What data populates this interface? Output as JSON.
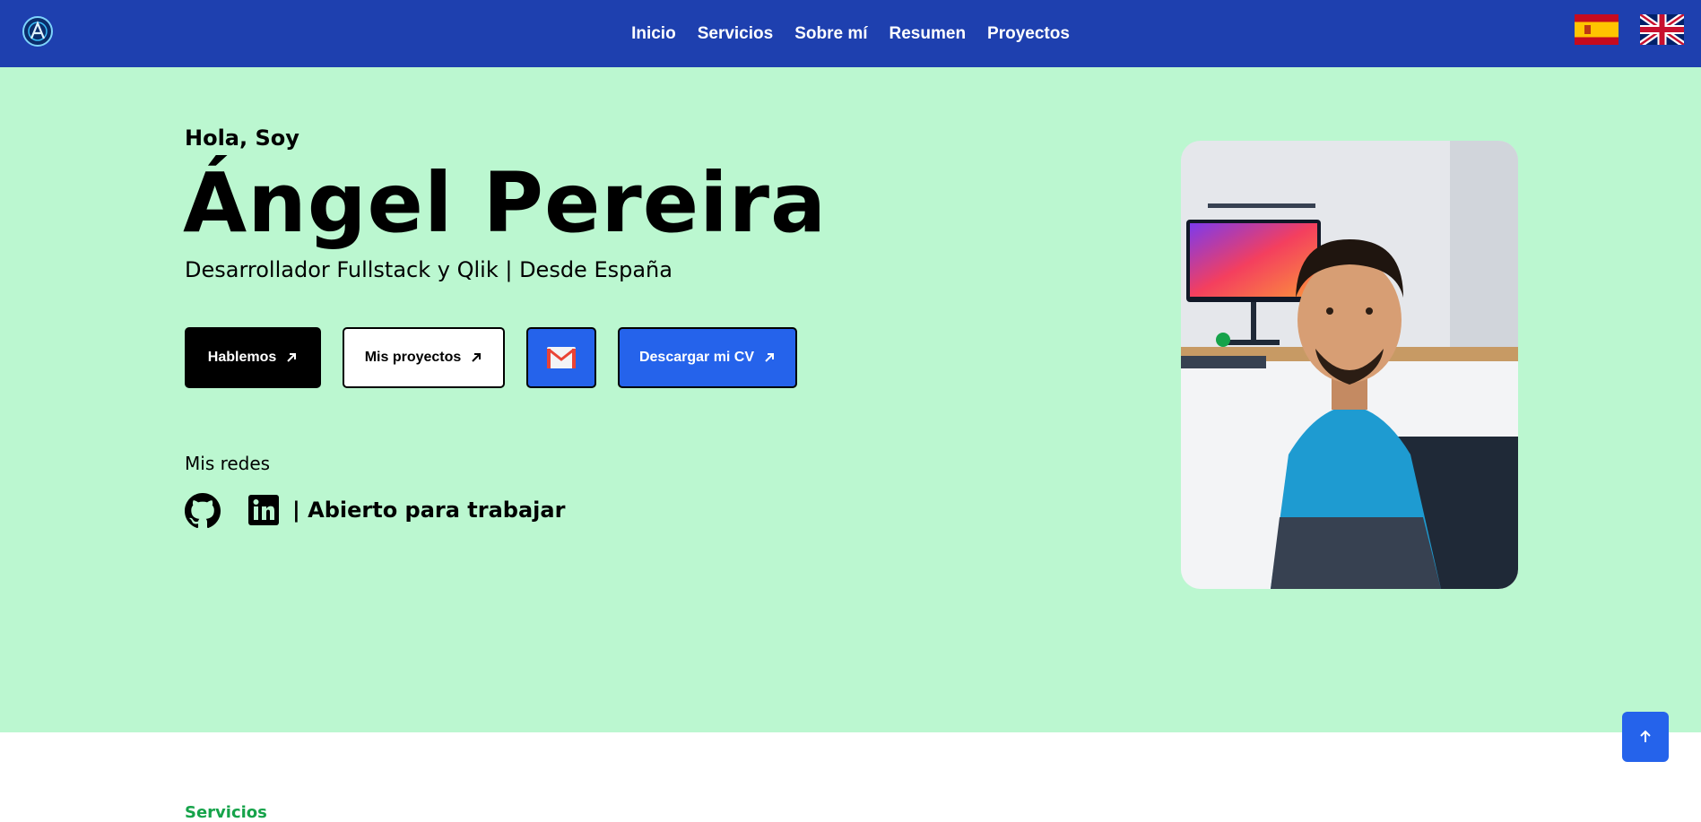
{
  "nav": {
    "items": [
      "Inicio",
      "Servicios",
      "Sobre mí",
      "Resumen",
      "Proyectos"
    ]
  },
  "hero": {
    "greeting": "Hola, Soy",
    "name": "Ángel Pereira",
    "role": "Desarrollador Fullstack y Qlik | Desde España",
    "buttons": {
      "talk": "Hablemos",
      "projects": "Mis proyectos",
      "cv": "Descargar mi CV"
    },
    "networks_title": "Mis redes",
    "status": "| Abierto para trabajar"
  },
  "next_section": {
    "label": "Servicios"
  },
  "colors": {
    "topbar": "#1e40af",
    "hero_bg": "#bbf7d0",
    "accent": "#2563eb",
    "section_label": "#16a34a"
  },
  "icons": [
    "logo-icon",
    "spain-flag-icon",
    "uk-flag-icon",
    "arrow-up-right-icon",
    "gmail-icon",
    "github-icon",
    "linkedin-icon",
    "arrow-up-icon"
  ]
}
